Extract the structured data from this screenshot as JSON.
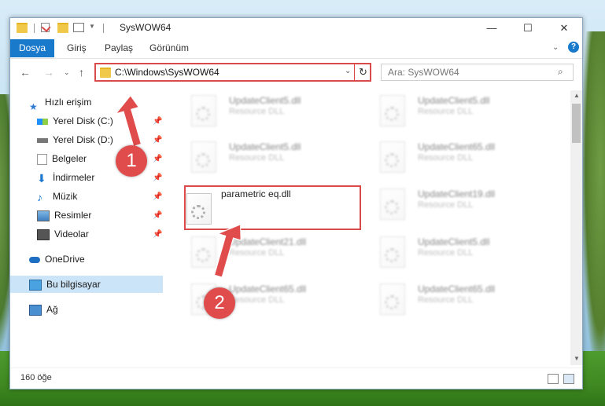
{
  "window": {
    "title": "SysWOW64"
  },
  "ribbon": {
    "tabs": [
      "Dosya",
      "Giriş",
      "Paylaş",
      "Görünüm"
    ]
  },
  "address": {
    "path": "C:\\Windows\\SysWOW64"
  },
  "search": {
    "placeholder": "Ara: SysWOW64"
  },
  "sidebar": {
    "quick_access": "Hızlı erişim",
    "items": [
      "Yerel Disk (C:)",
      "Yerel Disk (D:)",
      "Belgeler",
      "İndirmeler",
      "Müzik",
      "Resimler",
      "Videolar"
    ],
    "onedrive": "OneDrive",
    "this_pc": "Bu bilgisayar",
    "network": "Ağ"
  },
  "files": {
    "left": [
      {
        "name": "UpdateClient5.dll",
        "type": "Resource DLL"
      },
      {
        "name": "UpdateClient5.dll",
        "type": "Resource DLL"
      },
      {
        "name": "parametric eq.dll",
        "type": ""
      },
      {
        "name": "UpdateClient21.dll",
        "type": "Resource DLL"
      },
      {
        "name": "UpdateClient65.dll",
        "type": "Resource DLL"
      }
    ],
    "right": [
      {
        "name": "UpdateClient5.dll",
        "type": "Resource DLL"
      },
      {
        "name": "UpdateClient65.dll",
        "type": "Resource DLL"
      },
      {
        "name": "UpdateClient19.dll",
        "type": "Resource DLL"
      },
      {
        "name": "UpdateClient5.dll",
        "type": "Resource DLL"
      },
      {
        "name": "UpdateClient65.dll",
        "type": "Resource DLL"
      }
    ]
  },
  "status": {
    "count": "160 öğe"
  },
  "annotations": {
    "step1": "1",
    "step2": "2"
  },
  "colors": {
    "accent": "#1979ca",
    "highlight": "#d94b4b",
    "selection": "#cce4f7"
  }
}
